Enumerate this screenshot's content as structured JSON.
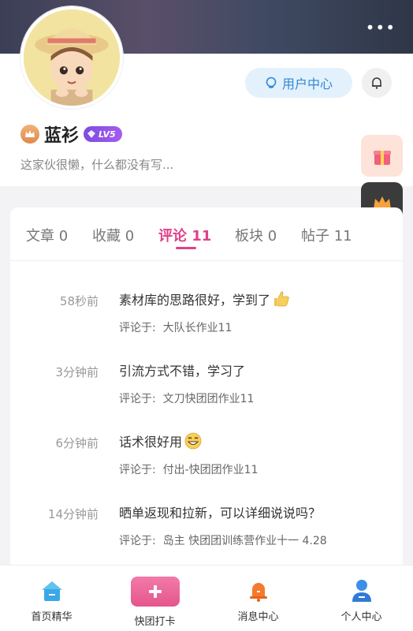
{
  "header": {
    "more_label": "•••"
  },
  "profile": {
    "user_center_label": "用户中心",
    "username": "蓝衫",
    "level": "LV5",
    "bio": "这家伙很懒，什么都没有写..."
  },
  "tabs": [
    {
      "label": "文章",
      "count": "0"
    },
    {
      "label": "收藏",
      "count": "0"
    },
    {
      "label": "评论",
      "count": "11"
    },
    {
      "label": "板块",
      "count": "0"
    },
    {
      "label": "帖子",
      "count": "11"
    }
  ],
  "active_tab_index": 2,
  "comments": [
    {
      "time": "58秒前",
      "text": "素材库的思路很好，学到了",
      "emoji": "thumbs-up-icon",
      "ref_prefix": "评论于:",
      "ref_title": "大队长作业11"
    },
    {
      "time": "3分钟前",
      "text": "引流方式不错，学习了",
      "emoji": "",
      "ref_prefix": "评论于:",
      "ref_title": "文刀快团团作业11"
    },
    {
      "time": "6分钟前",
      "text": "话术很好用",
      "emoji": "grin-face-icon",
      "ref_prefix": "评论于:",
      "ref_title": "付出-快团团作业11"
    },
    {
      "time": "14分钟前",
      "text": "晒单返现和拉新，可以详细说说吗？",
      "emoji": "",
      "ref_prefix": "评论于:",
      "ref_title": "岛主 快团团训练营作业十一 4.28"
    }
  ],
  "bottom_nav": [
    {
      "label": "首页精华",
      "icon": "home-icon"
    },
    {
      "label": "快团打卡",
      "icon": "plus-icon"
    },
    {
      "label": "消息中心",
      "icon": "bell-icon"
    },
    {
      "label": "个人中心",
      "icon": "person-icon"
    }
  ],
  "colors": {
    "accent_pink": "#e0408a",
    "user_center_blue": "#2f87d6",
    "level_purple": "#8a52e8"
  }
}
